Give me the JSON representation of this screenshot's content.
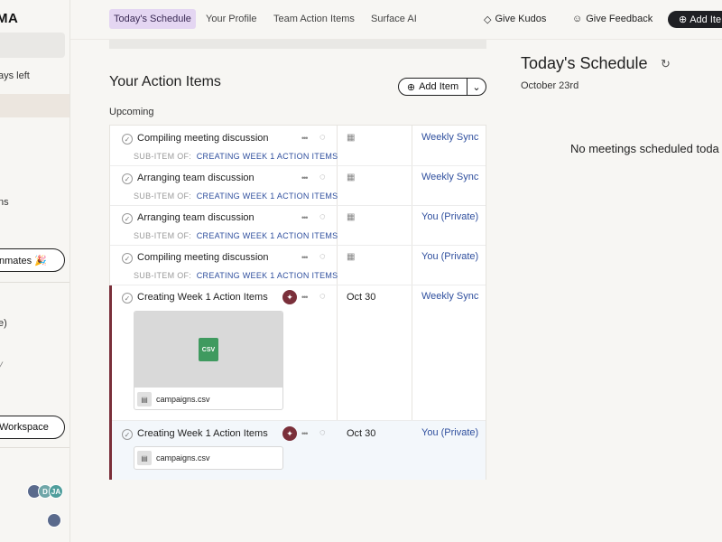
{
  "sidebar": {
    "logo_text": "MA",
    "days_left": "ays left",
    "ns_text": "ns",
    "invite_button": "nmates 🎉",
    "e_text": "e)",
    "y_text": "y",
    "workspace_button": "Workspace",
    "avatars": [
      "D",
      "JA"
    ]
  },
  "nav": {
    "tabs": [
      {
        "label": "Today's Schedule"
      },
      {
        "label": "Your Profile"
      },
      {
        "label": "Team Action Items"
      },
      {
        "label": "Surface AI"
      }
    ],
    "give_kudos": "Give Kudos",
    "give_feedback": "Give Feedback",
    "add_button": "Add Ite"
  },
  "main": {
    "heading": "Your Action Items",
    "add_item": "Add Item",
    "section": "Upcoming",
    "sub_label": "SUB-ITEM OF:",
    "rows": [
      {
        "title": "Compiling meeting discussion",
        "parent": "CREATING WEEK 1 ACTION ITEMS",
        "date": "",
        "meeting": "Weekly Sync"
      },
      {
        "title": "Arranging team discussion",
        "parent": "CREATING WEEK 1 ACTION ITEMS",
        "date": "",
        "meeting": "Weekly Sync"
      },
      {
        "title": "Arranging team discussion",
        "parent": "CREATING WEEK 1 ACTION ITEMS",
        "date": "",
        "meeting": "You (Private)"
      },
      {
        "title": "Compiling meeting discussion",
        "parent": "CREATING WEEK 1 ACTION ITEMS",
        "date": "",
        "meeting": "You (Private)"
      },
      {
        "title": "Creating Week 1 Action Items",
        "parent": "",
        "date": "Oct 30",
        "meeting": "Weekly Sync",
        "file": "campaigns.csv",
        "file_badge": "CSV"
      },
      {
        "title": "Creating Week 1 Action Items",
        "parent": "",
        "date": "Oct 30",
        "meeting": "You (Private)",
        "file": "campaigns.csv"
      }
    ]
  },
  "schedule": {
    "title": "Today's Schedule",
    "date": "October 23rd",
    "empty": "No meetings scheduled toda"
  },
  "colors": {
    "accent_active_tab": "#e4d6f2",
    "link": "#2f4f9e",
    "pin": "#7a2f3a",
    "csv": "#3f9a5f"
  },
  "icons": [
    "check-circle-icon",
    "more-icon",
    "comment-icon",
    "calendar-icon",
    "pin-icon",
    "refresh-icon",
    "diamond-icon",
    "feedback-icon",
    "plus-icon",
    "chevron-down-icon",
    "file-icon"
  ]
}
